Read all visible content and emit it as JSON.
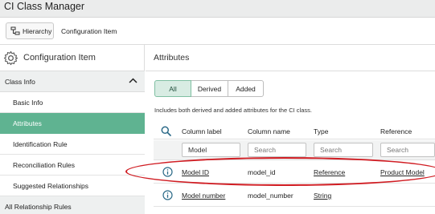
{
  "app": {
    "title": "CI Class Manager"
  },
  "breadcrumb": {
    "hierarchy_label": "Hierarchy",
    "current": "Configuration Item"
  },
  "sidebar": {
    "heading": "Configuration Item",
    "section": "Class Info",
    "items": [
      {
        "label": "Basic Info",
        "active": false
      },
      {
        "label": "Attributes",
        "active": true
      },
      {
        "label": "Identification Rule",
        "active": false
      },
      {
        "label": "Reconciliation Rules",
        "active": false
      },
      {
        "label": "Suggested Relationships",
        "active": false
      }
    ],
    "next_section": "All Relationship Rules"
  },
  "main": {
    "heading": "Attributes",
    "segments": {
      "all": "All",
      "derived": "Derived",
      "added": "Added",
      "selected": "All"
    },
    "description": "Includes both derived and added attributes for the CI class.",
    "columns": {
      "label": "Column label",
      "name": "Column name",
      "type": "Type",
      "reference": "Reference"
    },
    "filters": {
      "label_value": "Model",
      "label_placeholder": "Search",
      "name_placeholder": "Search",
      "type_placeholder": "Search",
      "reference_placeholder": "Search"
    },
    "rows": [
      {
        "label": "Model ID",
        "name": "model_id",
        "type": "Reference",
        "reference": "Product Model"
      },
      {
        "label": "Model number",
        "name": "model_number",
        "type": "String",
        "reference": ""
      }
    ]
  },
  "colors": {
    "accent": "#5fb391",
    "selected_segment": "#d8ece3",
    "highlight": "#d01c22"
  }
}
